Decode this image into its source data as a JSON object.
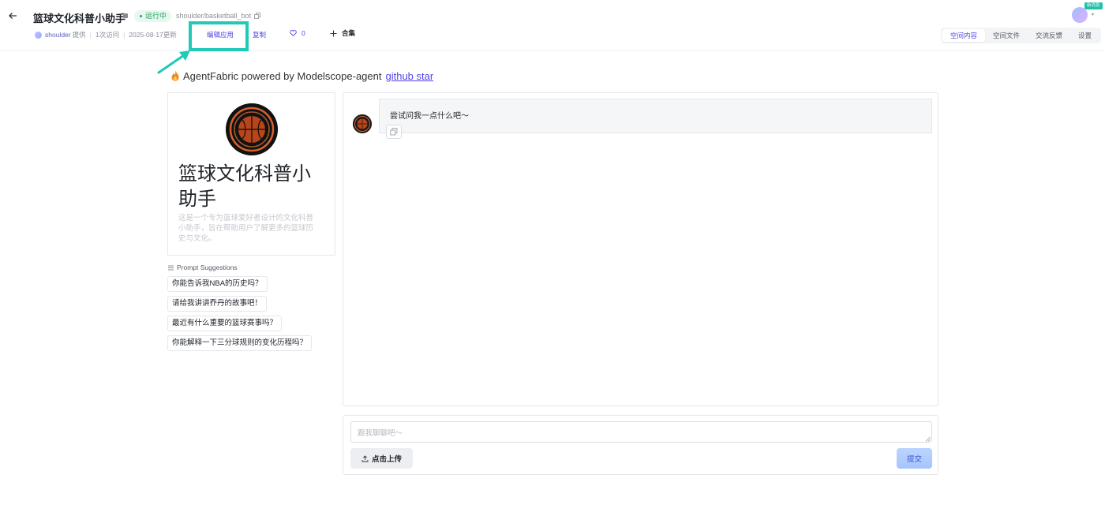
{
  "header": {
    "title": "篮球文化科普小助手",
    "status": "运行中",
    "repo_path": "shoulder/basketball_bot",
    "owner": "shoulder",
    "provided_label": "提供",
    "visits": "1次访问",
    "updated": "2025-08-17更新",
    "edit_app": "编辑应用",
    "copy": "复制",
    "likes": "0",
    "collect": "合集",
    "avatar_badge": "新消息",
    "tabs": [
      {
        "label": "空间内容",
        "active": true
      },
      {
        "label": "空间文件",
        "active": false
      },
      {
        "label": "交流反馈",
        "active": false
      },
      {
        "label": "设置",
        "active": false
      }
    ]
  },
  "banner": {
    "text": "AgentFabric powered by Modelscope-agent",
    "link": "github star"
  },
  "bot": {
    "name": "篮球文化科普小助手",
    "description": "这是一个专为篮球爱好者设计的文化科普小助手，旨在帮助用户了解更多的篮球历史与文化。"
  },
  "prompts": {
    "title": "Prompt Suggestions",
    "items": [
      "你能告诉我NBA的历史吗？",
      "请给我讲讲乔丹的故事吧！",
      "最近有什么重要的篮球赛事吗？",
      "你能解释一下三分球规则的变化历程吗？"
    ]
  },
  "chat": {
    "messages": [
      {
        "role": "bot",
        "text": "尝试问我一点什么吧～"
      }
    ]
  },
  "input": {
    "placeholder": "跟我聊聊吧～",
    "upload": "点击上传",
    "submit": "提交"
  },
  "colors": {
    "accent": "#4f46e5",
    "highlight": "#20c9b8",
    "status_green": "#1aa35a"
  }
}
